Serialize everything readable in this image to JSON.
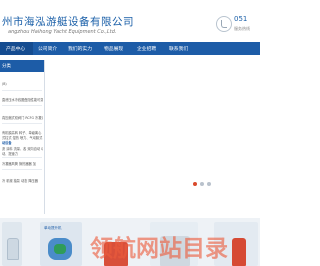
{
  "header": {
    "company_name_cn": "州市海泓游艇设备有限公司",
    "company_name_en": "angzhou Haihong Yacht Equipment Co.,Ltd.",
    "hotline_number": "051",
    "hotline_sub": "服务热线"
  },
  "nav": {
    "items": [
      "产品中心",
      "公司简介",
      "我们的实力",
      "物品展现",
      "企业招聘",
      "联系我们"
    ]
  },
  "sidebar": {
    "title": "分类",
    "items": [
      "",
      "",
      "(B)",
      "",
      "直泄压水冷线圈盘阻性能可变存",
      "",
      "真压缩式双阀门 RCFG 冷凝式",
      "",
      "有机膜高转 转子、单级离心",
      "式柱式 湿热 喷力、气动膜式",
      "动设备",
      "沥 涂料 流量、各 双向自动 动",
      "动、提速力",
      "",
      "冷凝器风筒 换热器器 加",
      "",
      "冷 机械 抽泵 动态 降压器"
    ]
  },
  "banner": {
    "active_slide": 1,
    "slide_count": 3
  },
  "products": {
    "thumb_label": "单动提升机",
    "watermark": "领航网站目录"
  },
  "colors": {
    "brand_blue": "#1d5ca7",
    "nav_active": "#154c90",
    "watermark": "#eb5c3c"
  }
}
